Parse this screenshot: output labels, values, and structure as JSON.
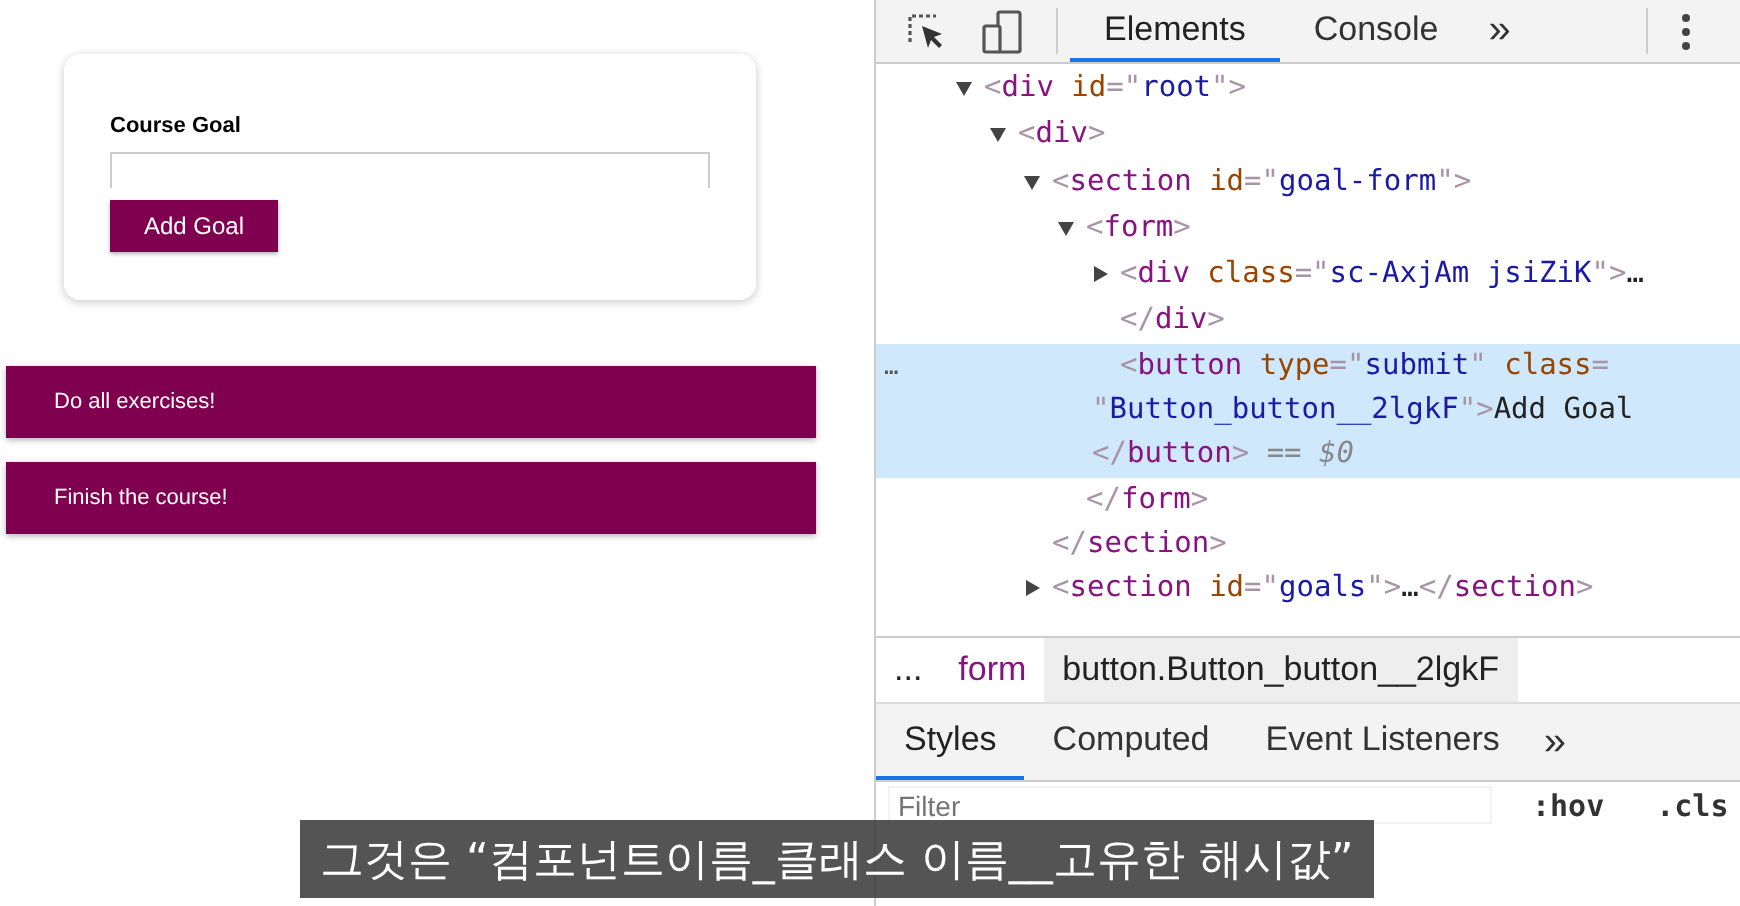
{
  "app": {
    "card": {
      "label": "Course Goal",
      "button": "Add Goal"
    },
    "goals": [
      {
        "text": "Do all exercises!"
      },
      {
        "text": "Finish the course!"
      }
    ]
  },
  "devtools": {
    "tabs": [
      {
        "label": "Elements",
        "selected": true
      },
      {
        "label": "Console",
        "selected": false
      }
    ],
    "tabs_more": "»",
    "dom": [
      {
        "selected": false,
        "expanded": true,
        "lines": [
          [
            {
              "kind": "bracket",
              "text": "<"
            },
            {
              "kind": "tag",
              "text": "div"
            },
            {
              "kind": "attr",
              "text": " id"
            },
            {
              "kind": "bracket",
              "text": "=\""
            },
            {
              "kind": "value",
              "text": "root"
            },
            {
              "kind": "bracket",
              "text": "\">"
            }
          ]
        ],
        "children": [
          {
            "selected": false,
            "expanded": true,
            "lines": [
              [
                {
                  "kind": "bracket",
                  "text": "<"
                },
                {
                  "kind": "tag",
                  "text": "div"
                },
                {
                  "kind": "bracket",
                  "text": ">"
                }
              ]
            ],
            "children": [
              {
                "selected": false,
                "expanded": true,
                "lines": [
                  [
                    {
                      "kind": "bracket",
                      "text": "<"
                    },
                    {
                      "kind": "tag",
                      "text": "section"
                    },
                    {
                      "kind": "attr",
                      "text": " id"
                    },
                    {
                      "kind": "bracket",
                      "text": "=\""
                    },
                    {
                      "kind": "value",
                      "text": "goal-form"
                    },
                    {
                      "kind": "bracket",
                      "text": "\">"
                    }
                  ]
                ],
                "close": [
                  [
                    {
                      "kind": "bracket",
                      "text": "</"
                    },
                    {
                      "kind": "tag",
                      "text": "section"
                    },
                    {
                      "kind": "bracket",
                      "text": ">"
                    }
                  ]
                ],
                "children": [
                  {
                    "selected": false,
                    "expanded": true,
                    "lines": [
                      [
                        {
                          "kind": "bracket",
                          "text": "<"
                        },
                        {
                          "kind": "tag",
                          "text": "form"
                        },
                        {
                          "kind": "bracket",
                          "text": ">"
                        }
                      ]
                    ],
                    "close": [
                      [
                        {
                          "kind": "bracket",
                          "text": "</"
                        },
                        {
                          "kind": "tag",
                          "text": "form"
                        },
                        {
                          "kind": "bracket",
                          "text": ">"
                        }
                      ]
                    ],
                    "children": [
                      {
                        "selected": false,
                        "expanded": false,
                        "lines": [
                          [
                            {
                              "kind": "bracket",
                              "text": "<"
                            },
                            {
                              "kind": "tag",
                              "text": "div"
                            },
                            {
                              "kind": "attr",
                              "text": " class"
                            },
                            {
                              "kind": "bracket",
                              "text": "=\""
                            },
                            {
                              "kind": "value",
                              "text": "sc-AxjAm jsiZiK"
                            },
                            {
                              "kind": "bracket",
                              "text": "\">"
                            },
                            {
                              "kind": "text",
                              "text": "…"
                            }
                          ],
                          [
                            {
                              "kind": "bracket",
                              "text": "</"
                            },
                            {
                              "kind": "tag",
                              "text": "div"
                            },
                            {
                              "kind": "bracket",
                              "text": ">"
                            }
                          ]
                        ]
                      },
                      {
                        "selected": true,
                        "gutter": "…",
                        "lines": [
                          [
                            {
                              "kind": "bracket",
                              "text": "<"
                            },
                            {
                              "kind": "tag",
                              "text": "button"
                            },
                            {
                              "kind": "attr",
                              "text": " type"
                            },
                            {
                              "kind": "bracket",
                              "text": "=\""
                            },
                            {
                              "kind": "value",
                              "text": "submit"
                            },
                            {
                              "kind": "bracket",
                              "text": "\""
                            },
                            {
                              "kind": "attr",
                              "text": " class"
                            },
                            {
                              "kind": "bracket",
                              "text": "="
                            }
                          ],
                          [
                            {
                              "kind": "bracket",
                              "text": "\""
                            },
                            {
                              "kind": "value",
                              "text": "Button_button__2lgkF"
                            },
                            {
                              "kind": "bracket",
                              "text": "\">"
                            },
                            {
                              "kind": "text",
                              "text": "Add Goal"
                            }
                          ],
                          [
                            {
                              "kind": "bracket",
                              "text": "</"
                            },
                            {
                              "kind": "tag",
                              "text": "button"
                            },
                            {
                              "kind": "bracket",
                              "text": ">"
                            },
                            {
                              "kind": "hint",
                              "text": " == $0"
                            }
                          ]
                        ]
                      }
                    ]
                  }
                ]
              },
              {
                "selected": false,
                "expanded": false,
                "lines": [
                  [
                    {
                      "kind": "bracket",
                      "text": "<"
                    },
                    {
                      "kind": "tag",
                      "text": "section"
                    },
                    {
                      "kind": "attr",
                      "text": " id"
                    },
                    {
                      "kind": "bracket",
                      "text": "=\""
                    },
                    {
                      "kind": "value",
                      "text": "goals"
                    },
                    {
                      "kind": "bracket",
                      "text": "\">"
                    },
                    {
                      "kind": "text",
                      "text": "…"
                    },
                    {
                      "kind": "bracket",
                      "text": "</"
                    },
                    {
                      "kind": "tag",
                      "text": "section"
                    },
                    {
                      "kind": "bracket",
                      "text": ">"
                    }
                  ]
                ]
              }
            ]
          }
        ]
      }
    ],
    "breadcrumbs": [
      {
        "text": "...",
        "kind": "more",
        "selected": false
      },
      {
        "text": "form",
        "kind": "tag",
        "selected": false
      },
      {
        "text": "button.Button_button__2lgkF",
        "kind": "tag",
        "selected": true
      }
    ],
    "pane_tabs": [
      {
        "label": "Styles",
        "selected": true
      },
      {
        "label": "Computed",
        "selected": false
      },
      {
        "label": "Event Listeners",
        "selected": false
      }
    ],
    "pane_tabs_more": "»",
    "filter": {
      "placeholder": "Filter",
      "hov": ":hov",
      "cls": ".cls"
    }
  },
  "caption": "그것은 “컴포넌트이름_클래스 이름__고유한 해시값”"
}
